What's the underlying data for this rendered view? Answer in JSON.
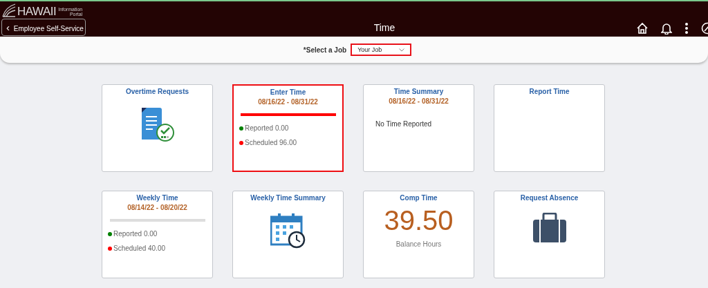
{
  "header": {
    "logo": {
      "name": "HAWAII",
      "tagline_1": "Information",
      "tagline_2": "Portal"
    },
    "back_button": {
      "icon": "‹",
      "label": "Employee Self-Service"
    },
    "title": "Time"
  },
  "job_select": {
    "label": "*Select a Job",
    "value": "Your Job",
    "highlighted": true
  },
  "tiles": [
    {
      "kind": "document",
      "title": "Overtime Requests",
      "highlighted": false
    },
    {
      "kind": "summary",
      "title": "Enter Time",
      "dates": "08/16/22 - 08/31/22",
      "highlighted": true,
      "bar": {
        "color": "#ff0000"
      },
      "lines": [
        {
          "text": "Reported 0.00",
          "color": "#008000"
        },
        {
          "text": "Scheduled 96.00",
          "color": "#ff0000"
        }
      ]
    },
    {
      "kind": "message",
      "title": "Time Summary",
      "dates": "08/16/22 - 08/31/22",
      "message": "No Time Reported",
      "highlighted": false
    },
    {
      "kind": "empty",
      "title": "Report Time",
      "highlighted": false
    },
    {
      "kind": "summary",
      "title": "Weekly Time",
      "dates": "08/14/22 - 08/20/22",
      "highlighted": false,
      "bar": {
        "color": "#dddddd"
      },
      "lines": [
        {
          "text": "Reported 0.00",
          "color": "#008000"
        },
        {
          "text": "Scheduled 40.00",
          "color": "#ff0000"
        }
      ]
    },
    {
      "kind": "calendar",
      "title": "Weekly Time Summary",
      "highlighted": false
    },
    {
      "kind": "balance",
      "title": "Comp Time",
      "value": "39.50",
      "caption": "Balance Hours",
      "highlighted": false
    },
    {
      "kind": "briefcase",
      "title": "Request Absence",
      "highlighted": false
    }
  ]
}
